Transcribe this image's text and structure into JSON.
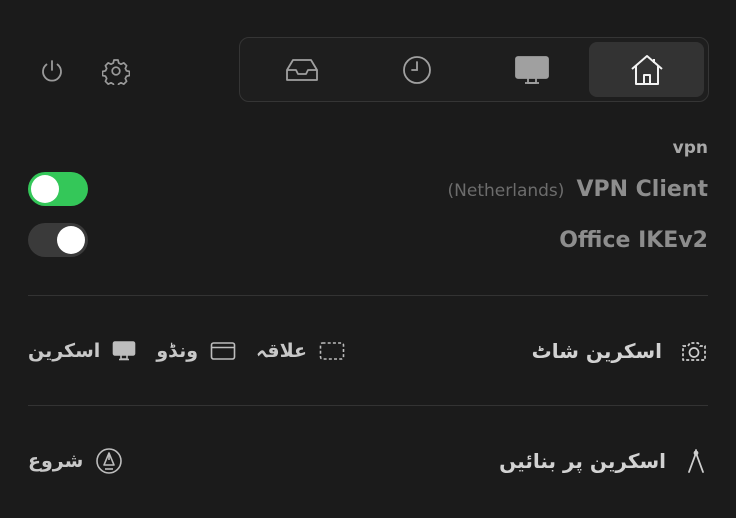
{
  "header": {
    "icons": [
      "power-icon",
      "gear-icon"
    ],
    "tabs": [
      {
        "icon": "inbox-tray-icon",
        "active": false
      },
      {
        "icon": "clock-icon",
        "active": false
      },
      {
        "icon": "display-icon",
        "active": false
      },
      {
        "icon": "home-icon",
        "active": true
      }
    ]
  },
  "vpn": {
    "section_label": "vpn",
    "connections": [
      {
        "name": "VPN Client",
        "detail": "(Netherlands)",
        "enabled": true
      },
      {
        "name": "Office IKEv2",
        "detail": "",
        "enabled": false
      }
    ]
  },
  "screenshot": {
    "title": "اسکرین شاٹ",
    "icon": "camera-icon",
    "options": [
      {
        "label": "علاقہ",
        "icon": "area-select-icon"
      },
      {
        "label": "ونڈو",
        "icon": "window-icon"
      },
      {
        "label": "اسکرین",
        "icon": "monitor-icon"
      }
    ]
  },
  "drawing": {
    "title": "اسکرین پر بنائیں",
    "icon": "compass-draw-icon",
    "action_label": "شروع",
    "action_icon": "pen-nib-circle-icon"
  },
  "colors": {
    "toggle_on": "#34c759",
    "toggle_off": "#3a3a3a",
    "background": "#1b1b1b"
  }
}
